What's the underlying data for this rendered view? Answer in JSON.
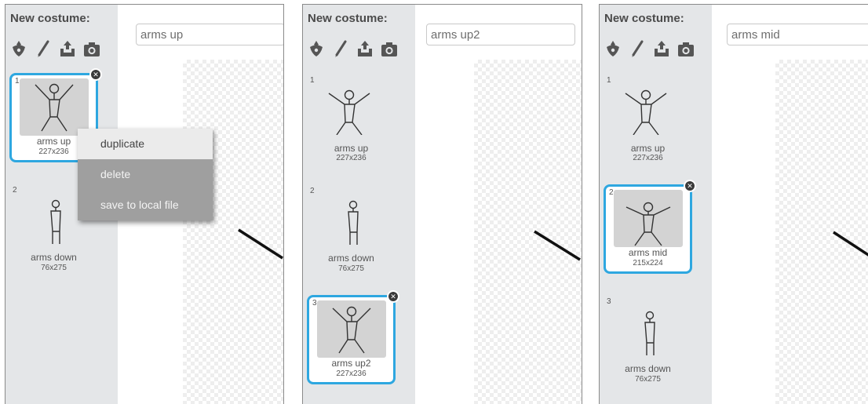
{
  "panels": [
    {
      "new_costume_label": "New costume:",
      "name_value": "arms up",
      "costumes": [
        {
          "index": "1",
          "name": "arms up",
          "size": "227x236",
          "pose": "up",
          "selected": true
        },
        {
          "index": "2",
          "name": "arms down",
          "size": "76x275",
          "pose": "down",
          "selected": false
        }
      ],
      "context_menu": [
        "duplicate",
        "delete",
        "save to local file"
      ]
    },
    {
      "new_costume_label": "New costume:",
      "name_value": "arms up2",
      "costumes": [
        {
          "index": "1",
          "name": "arms up",
          "size": "227x236",
          "pose": "up",
          "selected": false
        },
        {
          "index": "2",
          "name": "arms down",
          "size": "76x275",
          "pose": "down",
          "selected": false
        },
        {
          "index": "3",
          "name": "arms up2",
          "size": "227x236",
          "pose": "up",
          "selected": true
        }
      ]
    },
    {
      "new_costume_label": "New costume:",
      "name_value": "arms mid",
      "costumes": [
        {
          "index": "1",
          "name": "arms up",
          "size": "227x236",
          "pose": "up",
          "selected": false
        },
        {
          "index": "2",
          "name": "arms mid",
          "size": "215x224",
          "pose": "up",
          "selected": true
        },
        {
          "index": "3",
          "name": "arms down",
          "size": "76x275",
          "pose": "down",
          "selected": false
        }
      ]
    }
  ],
  "icons": [
    "paint-new-costume-icon",
    "brush-icon",
    "upload-icon",
    "camera-icon",
    "delete-costume-icon"
  ],
  "colors": {
    "selection_border": "#2ea7e0",
    "sidebar_bg": "#e4e6e8",
    "selected_thumb_bg": "#d3d3d3",
    "menu_first_bg": "#ebebeb",
    "menu_other_bg": "#9f9f9f"
  }
}
